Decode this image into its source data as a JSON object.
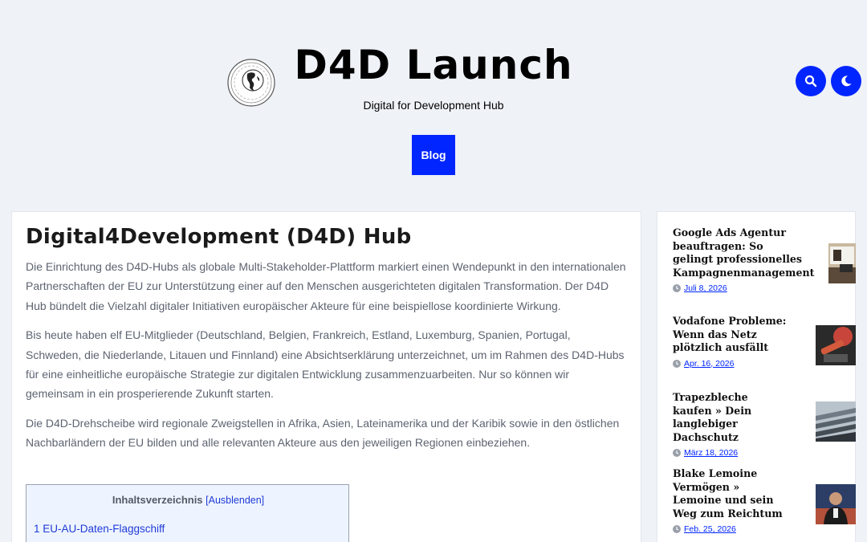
{
  "header": {
    "site_title": "D4D Launch",
    "tagline": "Digital for Development Hub",
    "logo_icon": "globe-logo-icon",
    "search_icon": "search-icon",
    "dark_mode_icon": "moon-icon",
    "accent_color": "#0025ff"
  },
  "nav": {
    "items": [
      {
        "label": "Blog"
      }
    ]
  },
  "article": {
    "title": "Digital4Development (D4D) Hub",
    "paragraphs": [
      "Die Einrichtung des D4D-Hubs als globale Multi-Stakeholder-Plattform markiert einen Wendepunkt in den internationalen Partnerschaften der EU zur Unterstützung einer auf den Menschen ausgerichteten digitalen Transformation. Der D4D Hub bündelt die Vielzahl digitaler Initiativen europäischer Akteure für eine beispiellose koordinierte Wirkung.",
      "Bis heute haben elf EU-Mitglieder (Deutschland, Belgien, Frankreich, Estland, Luxemburg, Spanien, Portugal, Schweden, die Niederlande, Litauen und Finnland) eine Absichtserklärung unterzeichnet, um im Rahmen des D4D-Hubs für eine einheitliche europäische Strategie zur digitalen Entwicklung zusammenzuarbeiten. Nur so können wir gemeinsam in ein prosperierende Zukunft starten.",
      "Die D4D-Drehscheibe wird regionale Zweigstellen in Afrika, Asien, Lateinamerika und der Karibik sowie in den östlichen Nachbarländern der EU bilden und alle relevanten Akteure aus den jeweiligen Regionen einbeziehen."
    ],
    "toc": {
      "title": "Inhaltsverzeichnis",
      "toggle_label": "[Ausblenden]",
      "items": [
        "1 EU-AU-Daten-Flaggschiff"
      ]
    }
  },
  "sidebar": {
    "posts": [
      {
        "title": "Google Ads Agentur beauftragen: So gelingt professionelles Kampagnenmanagement",
        "date": "Juli 8, 2026"
      },
      {
        "title": "Vodafone Probleme: Wenn das Netz plötzlich ausfällt",
        "date": "Apr. 16, 2026"
      },
      {
        "title": "Trapezbleche kaufen » Dein langlebiger Dachschutz",
        "date": "März 18, 2026"
      },
      {
        "title": "Blake Lemoine Vermögen » Lemoine und sein Weg zum Reichtum",
        "date": "Feb. 25, 2026"
      }
    ]
  }
}
